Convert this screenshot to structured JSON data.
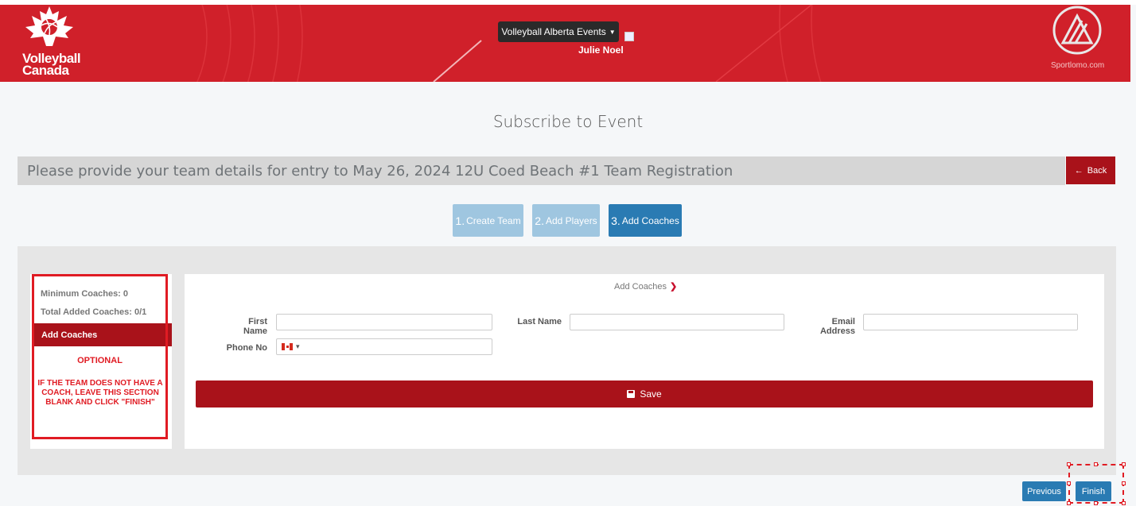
{
  "header": {
    "brand_line1": "Volleyball",
    "brand_line2": "Canada",
    "events_dropdown": "Volleyball Alberta Events",
    "user_name": "Julie Noel",
    "partner_text": "Sportlomo.com"
  },
  "page": {
    "title": "Subscribe to Event",
    "info_text": "Please provide your team details for entry to May 26, 2024 12U Coed Beach #1 Team Registration",
    "back_label": "Back"
  },
  "steps": [
    {
      "num": "1.",
      "label": "Create Team"
    },
    {
      "num": "2.",
      "label": "Add Players"
    },
    {
      "num": "3.",
      "label": "Add Coaches"
    }
  ],
  "sidebar": {
    "min_coaches": "Minimum Coaches: 0",
    "total_added": "Total Added Coaches: 0/1",
    "add_coaches": "Add Coaches",
    "optional": "OPTIONAL",
    "note": "IF THE TEAM DOES NOT HAVE A COACH, LEAVE THIS SECTION BLANK AND CLICK \"FINISH\""
  },
  "form": {
    "section_title": "Add Coaches",
    "first_name_label": "First Name",
    "first_name_value": "",
    "last_name_label": "Last Name",
    "last_name_value": "",
    "email_label": "Email Address",
    "email_value": "",
    "phone_label": "Phone No",
    "phone_value": "",
    "save_label": "Save"
  },
  "footer": {
    "previous_label": "Previous",
    "finish_label": "Finish"
  },
  "colors": {
    "brand_red": "#d0202a",
    "dark_red": "#a9121a",
    "primary_blue": "#2a7bb3",
    "light_blue": "#9fc6e0",
    "highlight_red": "#e01b23"
  },
  "icons": {
    "logo": "volleyball-canada-leaf-logo",
    "partner_logo": "sportlomo-logo",
    "back": "arrow-left-icon",
    "chevron": "chevron-down-icon",
    "save": "floppy-disk-icon",
    "flag": "canada-flag-icon"
  }
}
